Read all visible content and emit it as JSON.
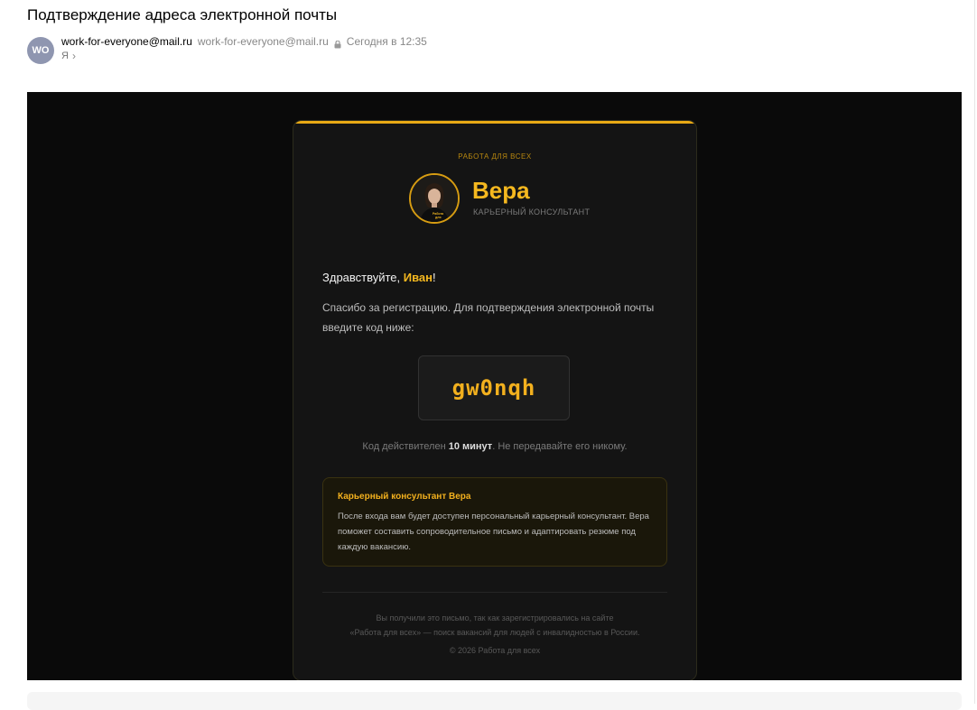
{
  "email": {
    "subject": "Подтверждение адреса электронной почты",
    "avatar_initials": "WO",
    "sender_name": "work-for-everyone@mail.ru",
    "sender_email": "work-for-everyone@mail.ru",
    "date": "Сегодня в 12:35",
    "recipient": "Я"
  },
  "card": {
    "brand_label": "РАБОТА ДЛЯ ВСЕХ",
    "assistant_name": "Вера",
    "assistant_role": "КАРЬЕРНЫЙ КОНСУЛЬТАНТ",
    "greeting_prefix": "Здравствуйте, ",
    "user_name": "Иван",
    "greeting_suffix": "!",
    "intro_text": "Спасибо за регистрацию. Для подтверждения электронной почты введите код ниже:",
    "code": "gw0nqh",
    "validity_prefix": "Код действителен ",
    "validity_bold": "10 минут",
    "validity_suffix": ". Не передавайте его никому.",
    "consultant_title": "Карьерный консультант Вера",
    "consultant_text": "После входа вам будет доступен персональный карьерный консультант. Вера поможет составить сопроводительное письмо и адаптировать резюме под каждую вакансию.",
    "footer_line1": "Вы получили это письмо, так как зарегистрировались на сайте",
    "footer_line2": "«Работа для всех» — поиск вакансий для людей с инвалидностью в России.",
    "footer_copyright": "© 2026 Работа для всех"
  },
  "colors": {
    "accent": "#f5b81f",
    "card_bg": "#141414",
    "frame_bg": "#0a0a0a",
    "avatar_bg": "#8f96b0"
  },
  "icons": {
    "lock": "lock-icon",
    "chevron": "chevron-right-icon",
    "logo": "assistant-portrait-logo"
  }
}
